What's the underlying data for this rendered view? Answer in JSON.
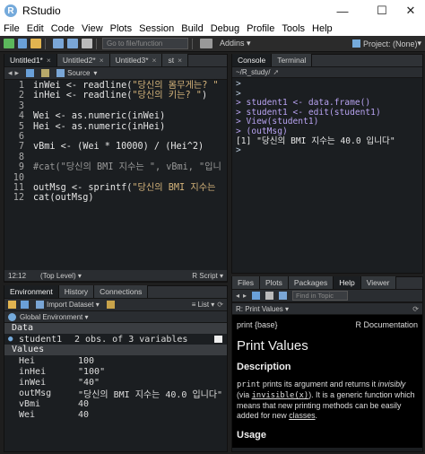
{
  "window": {
    "title": "RStudio",
    "app_icon": "R",
    "minimize": "—",
    "maximize": "☐",
    "close": "✕"
  },
  "menu": [
    "File",
    "Edit",
    "Code",
    "View",
    "Plots",
    "Session",
    "Build",
    "Debug",
    "Profile",
    "Tools",
    "Help"
  ],
  "toolbar": {
    "go_to_placeholder": "Go to file/function",
    "addins": "Addins",
    "project": "Project: (None)"
  },
  "editor": {
    "tabs": [
      "Untitled1*",
      "Untitled2*",
      "Untitled3*",
      "st"
    ],
    "source_label": "Source",
    "lines": [
      {
        "n": "1",
        "html": "inWei <- readline(<span class='str'>\"당신의 몸무게는? \"</span>"
      },
      {
        "n": "2",
        "html": "inHei <- readline(<span class='str'>\"당신의 키는? \"</span>)"
      },
      {
        "n": "3",
        "html": ""
      },
      {
        "n": "4",
        "html": "Wei <- as.numeric(inWei)"
      },
      {
        "n": "5",
        "html": "Hei <- as.numeric(inHei)"
      },
      {
        "n": "6",
        "html": ""
      },
      {
        "n": "7",
        "html": "vBmi <- (Wei * 10000) / (Hei^2)"
      },
      {
        "n": "8",
        "html": ""
      },
      {
        "n": "9",
        "html": "<span class='com'>#cat(\"당신의 BMI 지수는 \", vBmi, \"입니</span>"
      },
      {
        "n": "10",
        "html": ""
      },
      {
        "n": "11",
        "html": "outMsg <- sprintf(<span class='str'>\"당신의 BMI 지수는 </span>"
      },
      {
        "n": "12",
        "html": "cat(outMsg)"
      }
    ],
    "status_pos": "12:12",
    "status_level": "(Top Level)",
    "status_type": "R Script"
  },
  "console": {
    "tabs": [
      "Console",
      "Terminal"
    ],
    "path": "~/R_study/",
    "lines": [
      {
        "cls": "prompt",
        "text": ">"
      },
      {
        "cls": "prompt",
        "text": ">"
      },
      {
        "cls": "cmd",
        "text": "> student1 <- data.frame()"
      },
      {
        "cls": "cmd",
        "text": "> student1 <- edit(student1)"
      },
      {
        "cls": "cmd",
        "text": "> View(student1)"
      },
      {
        "cls": "cmd",
        "text": "> (outMsg)"
      },
      {
        "cls": "plain",
        "text": "[1] \"당신의 BMI 지수는 40.0 입니다\""
      },
      {
        "cls": "prompt",
        "text": ">"
      }
    ]
  },
  "environment": {
    "tabs": [
      "Environment",
      "History",
      "Connections"
    ],
    "import_label": "Import Dataset",
    "list_label": "List",
    "scope_label": "Global Environment",
    "data_header": "Data",
    "data_rows": [
      {
        "name": "student1",
        "value": "2 obs. of 3 variables"
      }
    ],
    "values_header": "Values",
    "values_rows": [
      {
        "name": "Hei",
        "value": "100"
      },
      {
        "name": "inHei",
        "value": "\"100\""
      },
      {
        "name": "inWei",
        "value": "\"40\""
      },
      {
        "name": "outMsg",
        "value": "\"당신의 BMI 지수는 40.0 입니다\""
      },
      {
        "name": "vBmi",
        "value": "40"
      },
      {
        "name": "Wei",
        "value": "40"
      }
    ]
  },
  "files": {
    "tabs": [
      "Files",
      "Plots",
      "Packages",
      "Help",
      "Viewer"
    ],
    "find_placeholder": "Find in Topic",
    "crumb": "R: Print Values",
    "help_pkg": "print {base}",
    "help_doc": "R Documentation",
    "help_title": "Print Values",
    "desc_heading": "Description",
    "desc_part1": "print",
    "desc_part2": " prints its argument and returns it ",
    "desc_part3": "invisibly",
    "desc_part4": " (via ",
    "desc_part5": "invisible(x)",
    "desc_part6": "). It is a generic function which means that new printing methods can be easily added for new ",
    "desc_part7": "classes",
    "desc_part8": ".",
    "usage_heading": "Usage"
  },
  "colors": {
    "accent": "#75aadb",
    "bg": "#262a2e"
  }
}
